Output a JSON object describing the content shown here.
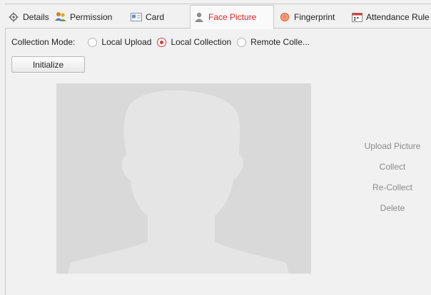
{
  "tabs": [
    {
      "label": "Details",
      "icon": "gear-icon"
    },
    {
      "label": "Permission",
      "icon": "users-icon"
    },
    {
      "label": "Card",
      "icon": "card-icon"
    },
    {
      "label": "Face Picture",
      "icon": "person-icon",
      "active": true
    },
    {
      "label": "Fingerprint",
      "icon": "fingerprint-icon"
    },
    {
      "label": "Attendance Rule",
      "icon": "calendar-icon"
    }
  ],
  "collection": {
    "label": "Collection Mode:",
    "options": [
      "Local Upload",
      "Local Collection",
      "Remote Colle..."
    ],
    "selected": "Local Collection"
  },
  "initialize_label": "Initialize",
  "actions": {
    "upload": "Upload Picture",
    "collect": "Collect",
    "recollect": "Re-Collect",
    "delete": "Delete"
  },
  "colors": {
    "accent": "#d22222",
    "placeholder_bg": "#d9d9d9",
    "placeholder_fg": "#e6e6e6",
    "disabled_text": "#8a8a8a"
  }
}
